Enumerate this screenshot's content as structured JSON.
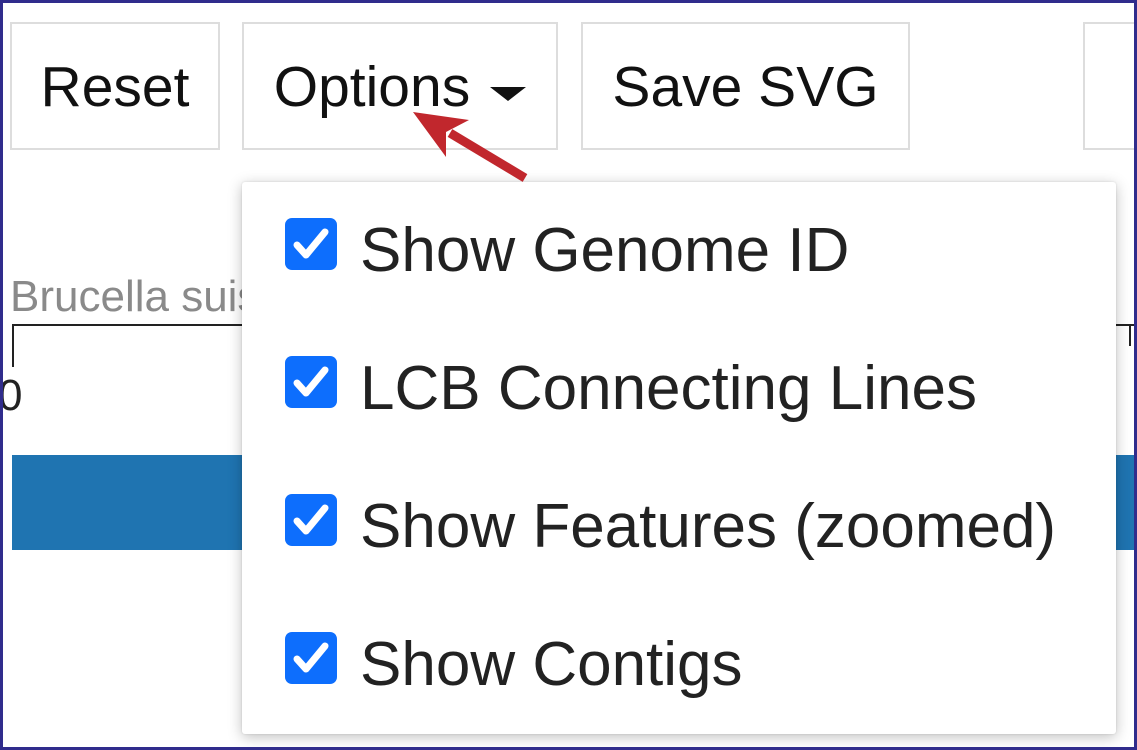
{
  "toolbar": {
    "buttons": [
      {
        "label": "Reset"
      },
      {
        "label": "Options",
        "icon": "caret-down-icon"
      },
      {
        "label": "Save SVG"
      }
    ]
  },
  "options_menu": {
    "items": [
      {
        "label": "Show Genome ID",
        "checked": true,
        "icon": "checkmark-icon"
      },
      {
        "label": "LCB Connecting Lines",
        "checked": true,
        "icon": "checkmark-icon"
      },
      {
        "label": "Show Features (zoomed)",
        "checked": true,
        "icon": "checkmark-icon"
      },
      {
        "label": "Show Contigs",
        "checked": true,
        "icon": "checkmark-icon"
      }
    ]
  },
  "viewer": {
    "genome_label": "Brucella suis",
    "axis_tick_label": "0"
  },
  "annotation": {
    "icon": "arrow-icon",
    "target": "Options"
  },
  "colors": {
    "checkbox": "#0d6efd",
    "annotation_arrow": "#c1272d",
    "genome_bar": "#1f74b1",
    "frame": "#302c8c"
  }
}
